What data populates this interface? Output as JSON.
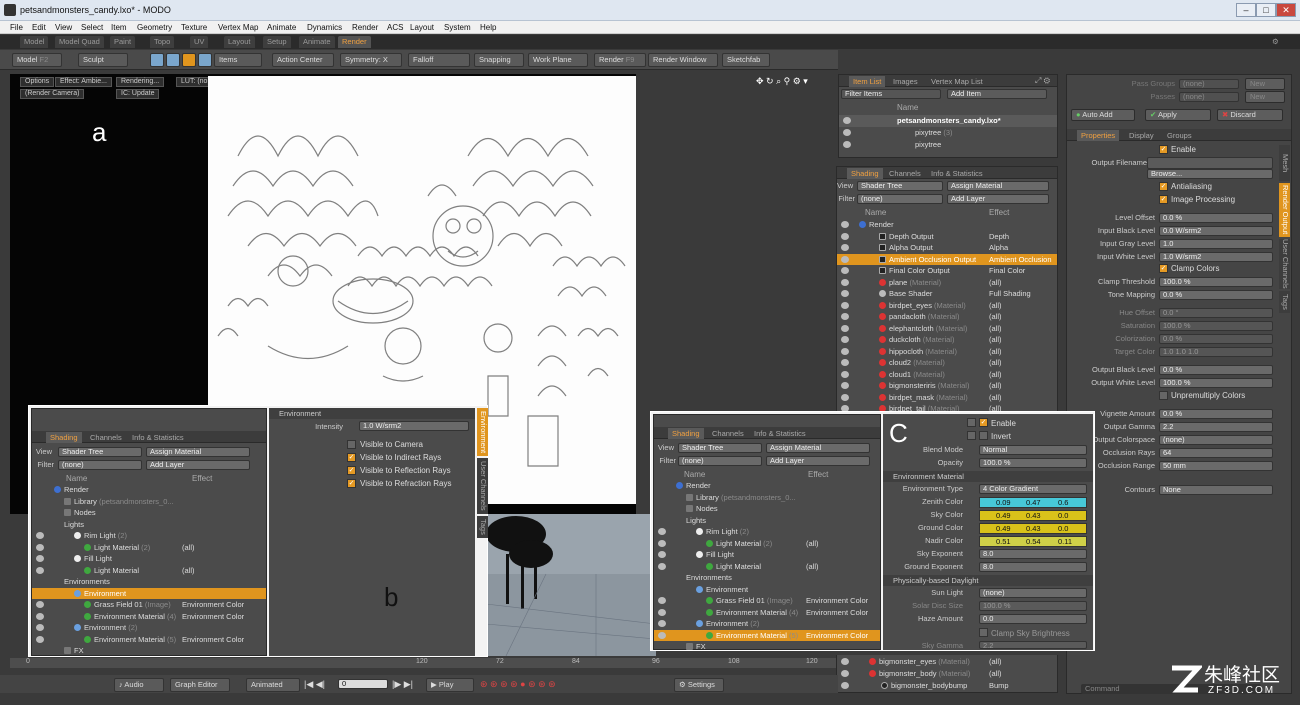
{
  "window": {
    "title": "petsandmonsters_candy.lxo* - MODO",
    "min": "–",
    "max": "□",
    "close": "✕"
  },
  "menu": [
    "File",
    "Edit",
    "View",
    "Select",
    "Item",
    "Geometry",
    "Texture",
    "Vertex Map",
    "Animate",
    "Dynamics",
    "Render",
    "ACS",
    "Layout",
    "System",
    "Help"
  ],
  "tabs": [
    "Model",
    "Model Quad",
    "Paint",
    "Topo",
    "UV",
    "Layout",
    "Setup",
    "Animate",
    "Render"
  ],
  "active_tab": "Render",
  "toolbar": {
    "model": "Model",
    "model_key": "F2",
    "sculpt": "Sculpt",
    "items": "Items",
    "action_center": "Action Center",
    "symmetry": "Symmetry: X",
    "falloff": "Falloff",
    "snapping": "Snapping",
    "work_plane": "Work Plane",
    "render": "Render",
    "render_key": "F9",
    "render_window": "Render Window",
    "sketchfab": "Sketchfab"
  },
  "viewport": {
    "options": "Options",
    "effect": "Effect: Ambie...",
    "rendering": "Rendering...",
    "lut": "LUT: (none)",
    "camera": "(Render Camera)",
    "ic": "IC: Update",
    "label_a": "a",
    "label_b": "b",
    "label_c": "C"
  },
  "item_list": {
    "tabs": [
      "Item List",
      "Images",
      "Vertex Map List"
    ],
    "filter": "Filter Items",
    "add_item": "Add Item",
    "col_name": "Name",
    "items": [
      {
        "name": "petsandmonsters_candy.lxo*",
        "note": ""
      },
      {
        "name": "pixytree",
        "note": "(3)"
      },
      {
        "name": "pixytree",
        "note": ""
      }
    ]
  },
  "shading": {
    "tabs": [
      "Shading",
      "Channels",
      "Info & Statistics"
    ],
    "view_label": "View",
    "view": "Shader Tree",
    "assign": "Assign Material",
    "filter_label": "Filter",
    "filter": "(none)",
    "add_layer": "Add Layer",
    "col_name": "Name",
    "col_effect": "Effect",
    "rows": [
      {
        "name": "Render",
        "note": "",
        "effect": ""
      },
      {
        "name": "Depth Output",
        "note": "",
        "effect": "Depth"
      },
      {
        "name": "Alpha Output",
        "note": "",
        "effect": "Alpha"
      },
      {
        "name": "Ambient Occlusion Output",
        "note": "",
        "effect": "Ambient Occlusion"
      },
      {
        "name": "Final Color Output",
        "note": "",
        "effect": "Final Color"
      },
      {
        "name": "plane",
        "note": "(Material)",
        "effect": "(all)"
      },
      {
        "name": "Base Shader",
        "note": "",
        "effect": "Full Shading"
      },
      {
        "name": "birdpet_eyes",
        "note": "(Material)",
        "effect": "(all)"
      },
      {
        "name": "pandacloth",
        "note": "(Material)",
        "effect": "(all)"
      },
      {
        "name": "elephantcloth",
        "note": "(Material)",
        "effect": "(all)"
      },
      {
        "name": "duckcloth",
        "note": "(Material)",
        "effect": "(all)"
      },
      {
        "name": "hippocloth",
        "note": "(Material)",
        "effect": "(all)"
      },
      {
        "name": "cloud2",
        "note": "(Material)",
        "effect": "(all)"
      },
      {
        "name": "cloud1",
        "note": "(Material)",
        "effect": "(all)"
      },
      {
        "name": "bigmonsteriris",
        "note": "(Material)",
        "effect": "(all)"
      },
      {
        "name": "birdpet_mask",
        "note": "(Material)",
        "effect": "(all)"
      },
      {
        "name": "birdpet_tail",
        "note": "(Material)",
        "effect": "(all)"
      }
    ],
    "bottom_rows": [
      {
        "name": "bigmonster_eyes",
        "note": "(Material)",
        "effect": "(all)"
      },
      {
        "name": "bigmonster_body",
        "note": "(Material)",
        "effect": "(all)"
      },
      {
        "name": "bigmonster_bodybump",
        "note": "",
        "effect": "Bump"
      }
    ]
  },
  "right": {
    "pass_groups": "Pass Groups",
    "passes": "Passes",
    "none": "(none)",
    "new": "New",
    "auto_add": "Auto Add",
    "apply": "Apply",
    "discard": "Discard",
    "tabs": [
      "Properties",
      "Display",
      "Groups"
    ],
    "vtabs": [
      "Mesh",
      "Render Output",
      "User Channels",
      "Tags"
    ],
    "enable": "Enable",
    "output_filename": "Output Filename",
    "browse": "Browse...",
    "antialiasing": "Antialiasing",
    "image_processing": "Image Processing",
    "props": [
      {
        "label": "Level Offset",
        "value": "0.0 %"
      },
      {
        "label": "Input Black Level",
        "value": "0.0 W/srm2"
      },
      {
        "label": "Input Gray Level",
        "value": "1.0"
      },
      {
        "label": "Input White Level",
        "value": "1.0 W/srm2"
      }
    ],
    "clamp_colors": "Clamp Colors",
    "props2": [
      {
        "label": "Clamp Threshold",
        "value": "100.0 %"
      },
      {
        "label": "Tone Mapping",
        "value": "0.0 %"
      }
    ],
    "props3": [
      {
        "label": "Hue Offset",
        "value": "0.0 °"
      },
      {
        "label": "Saturation",
        "value": "100.0 %"
      },
      {
        "label": "Colorization",
        "value": "0.0 %"
      },
      {
        "label": "Target Color",
        "value": "1.0      1.0      1.0"
      }
    ],
    "props4": [
      {
        "label": "Output Black Level",
        "value": "0.0 %"
      },
      {
        "label": "Output White Level",
        "value": "100.0 %"
      }
    ],
    "unpremultiply": "Unpremultiply Colors",
    "props5": [
      {
        "label": "Vignette Amount",
        "value": "0.0 %"
      },
      {
        "label": "Output Gamma",
        "value": "2.2"
      },
      {
        "label": "Output Colorspace",
        "value": "(none)"
      },
      {
        "label": "Occlusion Rays",
        "value": "64"
      },
      {
        "label": "Occlusion Range",
        "value": "50 mm"
      }
    ],
    "contours": "Contours",
    "contours_value": "None",
    "command": "Command"
  },
  "panel_b": {
    "title": "Environment",
    "intensity_label": "Intensity",
    "intensity": "1.0 W/srm2",
    "checks": [
      "Visible to Camera",
      "Visible to Indirect Rays",
      "Visible to Reflection Rays",
      "Visible to Refraction Rays"
    ],
    "vtabs": [
      "Environment",
      "User Channels",
      "Tags"
    ],
    "rows": [
      {
        "name": "Render",
        "note": "",
        "effect": ""
      },
      {
        "name": "Library",
        "note": "(petsandmonsters_0...",
        "effect": ""
      },
      {
        "name": "Nodes",
        "note": "",
        "effect": ""
      },
      {
        "name": "Lights",
        "note": "",
        "effect": ""
      },
      {
        "name": "Rim Light",
        "note": "(2)",
        "effect": ""
      },
      {
        "name": "Light Material",
        "note": "(2)",
        "effect": "(all)"
      },
      {
        "name": "Fill Light",
        "note": "",
        "effect": ""
      },
      {
        "name": "Light Material",
        "note": "",
        "effect": "(all)"
      },
      {
        "name": "Environments",
        "note": "",
        "effect": ""
      },
      {
        "name": "Environment",
        "note": "",
        "effect": ""
      },
      {
        "name": "Grass Field 01",
        "note": "(Image)",
        "effect": "Environment Color"
      },
      {
        "name": "Environment Material",
        "note": "(4)",
        "effect": "Environment Color"
      },
      {
        "name": "Environment",
        "note": "(2)",
        "effect": ""
      },
      {
        "name": "Environment Material",
        "note": "(5)",
        "effect": "Environment Color"
      },
      {
        "name": "FX",
        "note": "",
        "effect": ""
      }
    ]
  },
  "panel_c": {
    "enable": "Enable",
    "invert": "Invert",
    "blend_label": "Blend Mode",
    "blend": "Normal",
    "opacity_label": "Opacity",
    "opacity": "100.0 %",
    "env_material": "Environment Material",
    "env_type_label": "Environment Type",
    "env_type": "4 Color Gradient",
    "colors": [
      {
        "label": "Zenith Color",
        "r": "0.09",
        "g": "0.47",
        "b": "0.6",
        "hex": "#47c8d8"
      },
      {
        "label": "Sky Color",
        "r": "0.49",
        "g": "0.43",
        "b": "0.0",
        "hex": "#d9c21a"
      },
      {
        "label": "Ground Color",
        "r": "0.49",
        "g": "0.43",
        "b": "0.0",
        "hex": "#d9c21a"
      },
      {
        "label": "Nadir Color",
        "r": "0.51",
        "g": "0.54",
        "b": "0.11",
        "hex": "#cfd048"
      }
    ],
    "sky_exp_label": "Sky Exponent",
    "sky_exp": "8.0",
    "ground_exp_label": "Ground Exponent",
    "ground_exp": "8.0",
    "daylight": "Physically-based Daylight",
    "sun_label": "Sun Light",
    "sun": "(none)",
    "disc_label": "Solar Disc Size",
    "disc": "100.0 %",
    "haze_label": "Haze Amount",
    "haze": "0.0",
    "clamp_sky": "Clamp Sky Brightness",
    "gamma_label": "Sky Gamma",
    "gamma": "2.2",
    "rows": [
      {
        "name": "Render",
        "note": "",
        "effect": ""
      },
      {
        "name": "Library",
        "note": "(petsandmonsters_0...",
        "effect": ""
      },
      {
        "name": "Nodes",
        "note": "",
        "effect": ""
      },
      {
        "name": "Lights",
        "note": "",
        "effect": ""
      },
      {
        "name": "Rim Light",
        "note": "(2)",
        "effect": ""
      },
      {
        "name": "Light Material",
        "note": "(2)",
        "effect": "(all)"
      },
      {
        "name": "Fill Light",
        "note": "",
        "effect": ""
      },
      {
        "name": "Light Material",
        "note": "",
        "effect": "(all)"
      },
      {
        "name": "Environments",
        "note": "",
        "effect": ""
      },
      {
        "name": "Environment",
        "note": "",
        "effect": ""
      },
      {
        "name": "Grass Field 01",
        "note": "(Image)",
        "effect": "Environment Color"
      },
      {
        "name": "Environment Material",
        "note": "(4)",
        "effect": "Environment Color"
      },
      {
        "name": "Environment",
        "note": "(2)",
        "effect": ""
      },
      {
        "name": "Environment Material",
        "note": "(5)",
        "effect": "Environment Color"
      },
      {
        "name": "FX",
        "note": "",
        "effect": ""
      }
    ]
  },
  "timeline": {
    "ticks": [
      "0",
      "120",
      "72",
      "84",
      "96",
      "108",
      "120"
    ]
  },
  "bottom": {
    "audio": "Audio",
    "graph_editor": "Graph Editor",
    "animated": "Animated",
    "frame": "0",
    "play": "Play",
    "settings": "Settings"
  },
  "watermark": {
    "text": "朱峰社区",
    "url": "ZF3D.COM"
  }
}
